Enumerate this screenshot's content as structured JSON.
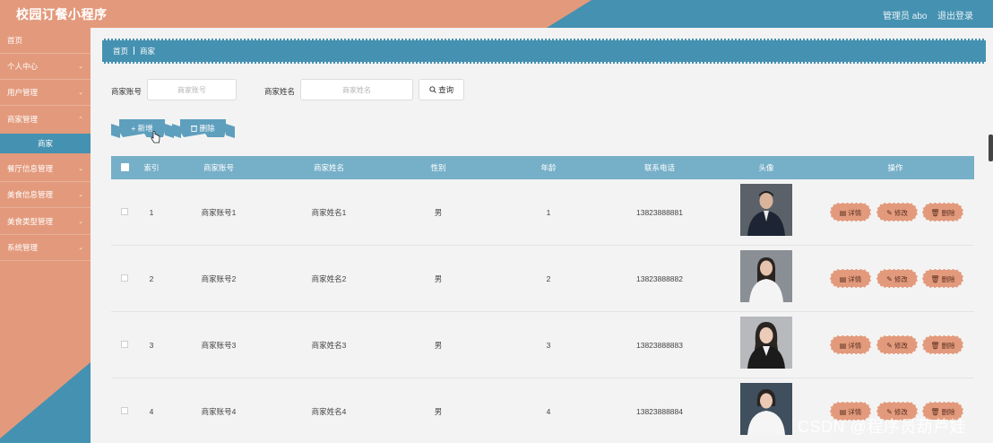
{
  "header": {
    "title": "校园订餐小程序",
    "admin": "管理员 abo",
    "logout": "退出登录"
  },
  "sidebar": {
    "items": [
      {
        "label": "首页",
        "chevron": false
      },
      {
        "label": "个人中心",
        "chevron": true
      },
      {
        "label": "用户管理",
        "chevron": true
      },
      {
        "label": "商家管理",
        "chevron": true
      },
      {
        "label": "餐厅信息管理",
        "chevron": true
      },
      {
        "label": "美食信息管理",
        "chevron": true
      },
      {
        "label": "美食类型管理",
        "chevron": true
      },
      {
        "label": "系统管理",
        "chevron": true
      }
    ],
    "active_sub": "商家"
  },
  "breadcrumb": {
    "home": "首页",
    "current": "商家"
  },
  "search": {
    "account_label": "商家账号",
    "account_placeholder": "商家账号",
    "name_label": "商家姓名",
    "name_placeholder": "商家姓名",
    "query_label": "查询",
    "query_icon": "search-icon"
  },
  "actions": {
    "add_label": "新增",
    "add_icon": "plus-icon",
    "delete_label": "删除",
    "delete_icon": "trash-icon"
  },
  "table": {
    "headers": [
      "索引",
      "商家账号",
      "商家姓名",
      "性别",
      "年龄",
      "联系电话",
      "头像",
      "操作"
    ],
    "rows": [
      {
        "index": "1",
        "account": "商家账号1",
        "name": "商家姓名1",
        "gender": "男",
        "age": "1",
        "phone": "13823888881"
      },
      {
        "index": "2",
        "account": "商家账号2",
        "name": "商家姓名2",
        "gender": "男",
        "age": "2",
        "phone": "13823888882"
      },
      {
        "index": "3",
        "account": "商家账号3",
        "name": "商家姓名3",
        "gender": "男",
        "age": "3",
        "phone": "13823888883"
      },
      {
        "index": "4",
        "account": "商家账号4",
        "name": "商家姓名4",
        "gender": "男",
        "age": "4",
        "phone": "13823888884"
      }
    ],
    "row_ops": {
      "detail": "详情",
      "edit": "修改",
      "delete": "删除"
    }
  },
  "watermark": "CSDN @程序员葫芦娃",
  "colors": {
    "salmon": "#e39a7c",
    "blue": "#4591b1",
    "table_header": "#76afc8"
  }
}
